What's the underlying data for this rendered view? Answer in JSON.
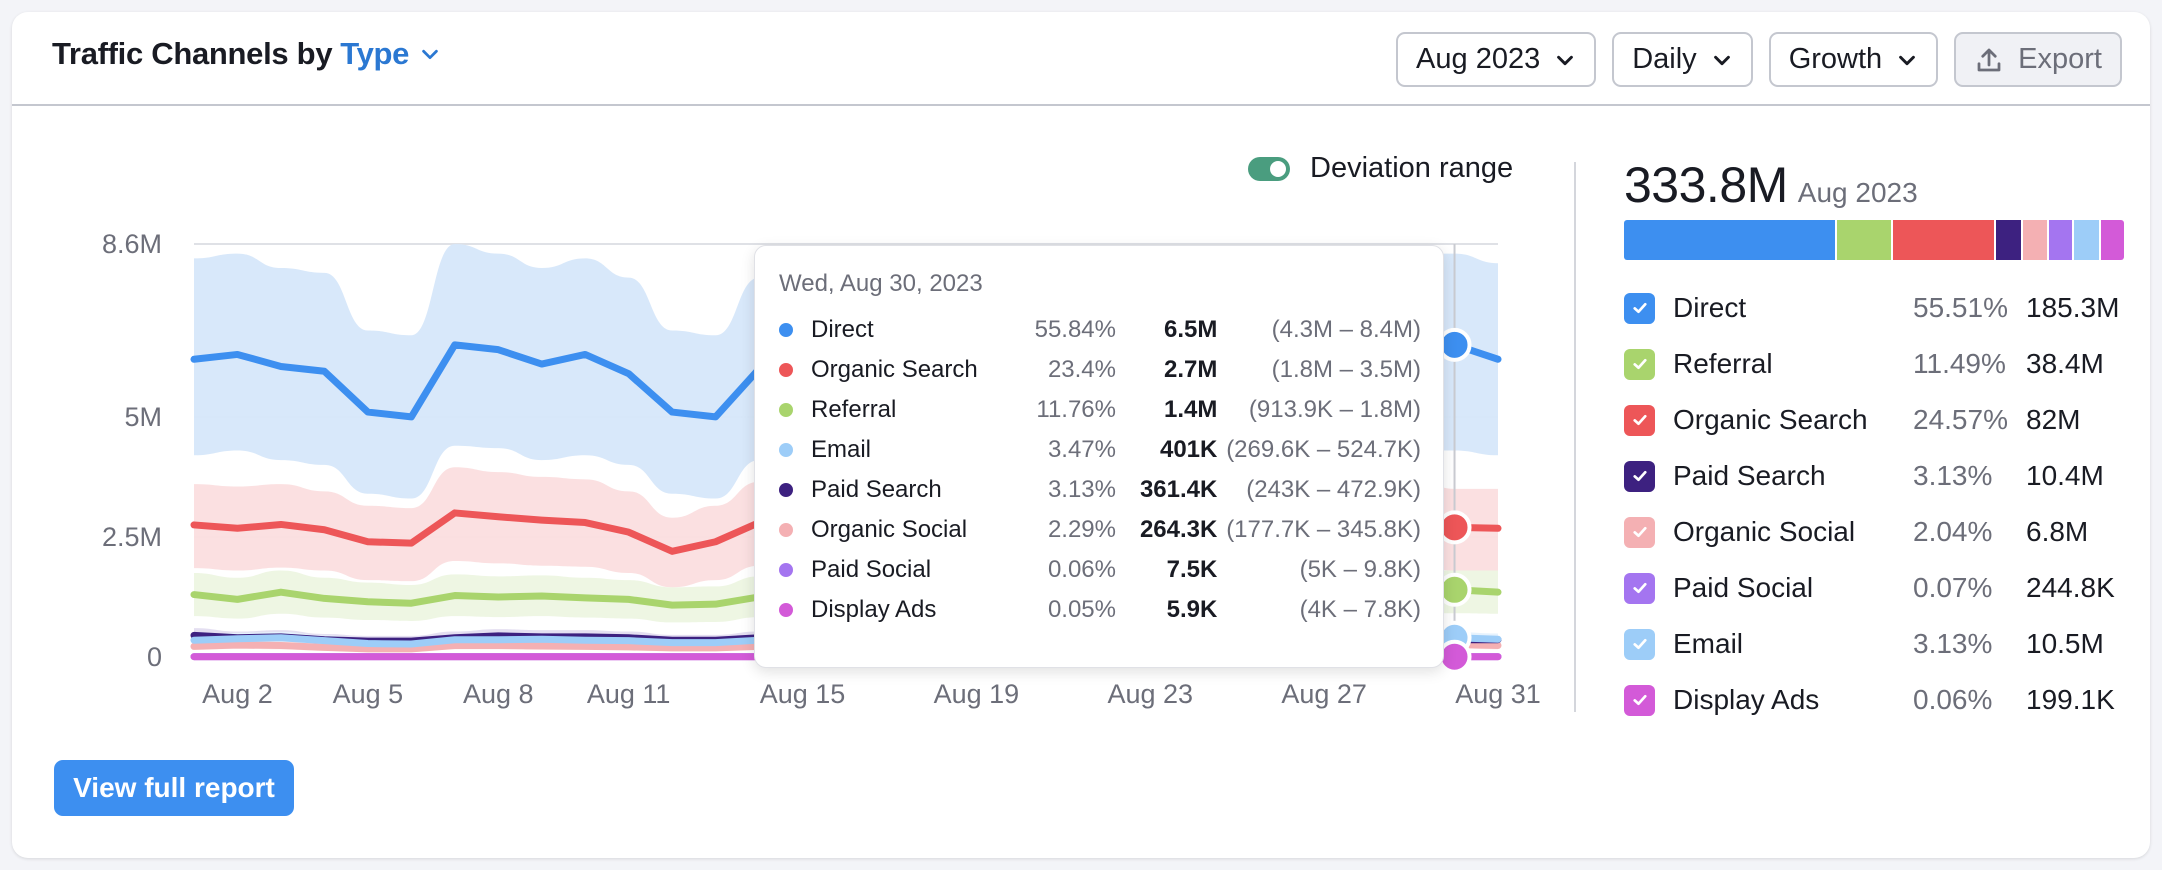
{
  "header": {
    "title_prefix": "Traffic Channels by",
    "title_type": "Type",
    "controls": {
      "period": "Aug 2023",
      "granularity": "Daily",
      "metric": "Growth",
      "export": "Export"
    }
  },
  "toggle": {
    "label": "Deviation range",
    "on": true
  },
  "summary": {
    "total": "333.8M",
    "period": "Aug 2023"
  },
  "legend": [
    {
      "name": "Direct",
      "pct": "55.51%",
      "value": "185.3M",
      "color": "#3d8ff0",
      "share": 55.51,
      "checked": true
    },
    {
      "name": "Referral",
      "pct": "11.49%",
      "value": "38.4M",
      "color": "#a9d46d",
      "share": 11.49,
      "checked": true
    },
    {
      "name": "Organic Search",
      "pct": "24.57%",
      "value": "82M",
      "color": "#ed5658",
      "share": 24.57,
      "checked": true
    },
    {
      "name": "Paid Search",
      "pct": "3.13%",
      "value": "10.4M",
      "color": "#3d2180",
      "share": 3.13,
      "checked": true
    },
    {
      "name": "Organic Social",
      "pct": "2.04%",
      "value": "6.8M",
      "color": "#f4b0b3",
      "share": 2.04,
      "checked": true
    },
    {
      "name": "Paid Social",
      "pct": "0.07%",
      "value": "244.8K",
      "color": "#a475f0",
      "share": 0.07,
      "checked": true
    },
    {
      "name": "Email",
      "pct": "3.13%",
      "value": "10.5M",
      "color": "#9dcdf8",
      "share": 3.13,
      "checked": true
    },
    {
      "name": "Display Ads",
      "pct": "0.06%",
      "value": "199.1K",
      "color": "#d35ad8",
      "share": 0.06,
      "checked": true
    }
  ],
  "tooltip": {
    "date": "Wed, Aug 30, 2023",
    "rows": [
      {
        "name": "Direct",
        "pct": "55.84%",
        "value": "6.5M",
        "range": "(4.3M – 8.4M)",
        "color": "#3d8ff0"
      },
      {
        "name": "Organic Search",
        "pct": "23.4%",
        "value": "2.7M",
        "range": "(1.8M – 3.5M)",
        "color": "#ed5658"
      },
      {
        "name": "Referral",
        "pct": "11.76%",
        "value": "1.4M",
        "range": "(913.9K – 1.8M)",
        "color": "#a9d46d"
      },
      {
        "name": "Email",
        "pct": "3.47%",
        "value": "401K",
        "range": "(269.6K – 524.7K)",
        "color": "#9dcdf8"
      },
      {
        "name": "Paid Search",
        "pct": "3.13%",
        "value": "361.4K",
        "range": "(243K – 472.9K)",
        "color": "#3d2180"
      },
      {
        "name": "Organic Social",
        "pct": "2.29%",
        "value": "264.3K",
        "range": "(177.7K – 345.8K)",
        "color": "#f4b0b3"
      },
      {
        "name": "Paid Social",
        "pct": "0.06%",
        "value": "7.5K",
        "range": "(5K – 9.8K)",
        "color": "#a475f0"
      },
      {
        "name": "Display Ads",
        "pct": "0.05%",
        "value": "5.9K",
        "range": "(4K – 7.8K)",
        "color": "#d35ad8"
      }
    ]
  },
  "view_full_report": "View full report",
  "chart_data": {
    "type": "line",
    "title": "Traffic Channels by Type",
    "xlabel": "",
    "ylabel": "",
    "x": [
      "Aug 1",
      "Aug 2",
      "Aug 3",
      "Aug 4",
      "Aug 5",
      "Aug 6",
      "Aug 7",
      "Aug 8",
      "Aug 9",
      "Aug 10",
      "Aug 11",
      "Aug 12",
      "Aug 13",
      "Aug 14",
      "Aug 15",
      "Aug 16",
      "Aug 17",
      "Aug 18",
      "Aug 19",
      "Aug 20",
      "Aug 21",
      "Aug 22",
      "Aug 23",
      "Aug 24",
      "Aug 25",
      "Aug 26",
      "Aug 27",
      "Aug 28",
      "Aug 29",
      "Aug 30",
      "Aug 31"
    ],
    "x_ticks": [
      "Aug 2",
      "Aug 5",
      "Aug 8",
      "Aug 11",
      "Aug 15",
      "Aug 19",
      "Aug 23",
      "Aug 27",
      "Aug 31"
    ],
    "y_ticks": [
      {
        "value": 0,
        "label": "0"
      },
      {
        "value": 2.5,
        "label": "2.5M"
      },
      {
        "value": 5,
        "label": "5M"
      },
      {
        "value": 8.6,
        "label": "8.6M"
      }
    ],
    "ylim": [
      0,
      8.6
    ],
    "units": "millions",
    "grid": true,
    "hover_index": 29,
    "series": [
      {
        "name": "Direct",
        "color": "#3d8ff0",
        "band": "#d6e7fa",
        "values": [
          6.2,
          6.3,
          6.05,
          5.95,
          5.1,
          5.0,
          6.5,
          6.4,
          6.1,
          6.3,
          5.9,
          5.1,
          5.0,
          6.0,
          6.2,
          6.3,
          6.1,
          6.0,
          5.3,
          5.2,
          6.3,
          6.4,
          6.2,
          6.3,
          6.0,
          5.3,
          5.2,
          6.3,
          6.4,
          6.5,
          6.2
        ],
        "lower": [
          4.2,
          4.3,
          4.1,
          4.0,
          3.4,
          3.3,
          4.4,
          4.35,
          4.1,
          4.2,
          4.0,
          3.4,
          3.3,
          4.1,
          4.2,
          4.3,
          4.1,
          4.0,
          3.5,
          3.4,
          4.3,
          4.4,
          4.2,
          4.3,
          4.0,
          3.5,
          3.4,
          4.2,
          4.3,
          4.3,
          4.2
        ],
        "upper": [
          8.3,
          8.4,
          8.1,
          8.0,
          6.8,
          6.7,
          8.6,
          8.4,
          8.1,
          8.3,
          7.9,
          6.8,
          6.7,
          7.9,
          8.3,
          8.4,
          8.1,
          8.0,
          7.0,
          6.9,
          8.3,
          8.4,
          8.2,
          8.3,
          8.0,
          7.0,
          6.9,
          8.3,
          8.4,
          8.4,
          8.2
        ]
      },
      {
        "name": "Organic Search",
        "color": "#ed5658",
        "band": "#fbdedf",
        "values": [
          2.75,
          2.68,
          2.76,
          2.65,
          2.4,
          2.37,
          3.0,
          2.92,
          2.85,
          2.8,
          2.6,
          2.2,
          2.4,
          2.8,
          2.85,
          2.9,
          2.8,
          2.75,
          2.5,
          2.45,
          2.85,
          2.9,
          2.8,
          2.82,
          2.7,
          2.5,
          2.45,
          2.8,
          2.85,
          2.7,
          2.68
        ],
        "lower": [
          1.85,
          1.8,
          1.86,
          1.8,
          1.6,
          1.58,
          2.0,
          1.95,
          1.9,
          1.88,
          1.75,
          1.45,
          1.6,
          1.9,
          1.9,
          1.95,
          1.9,
          1.85,
          1.65,
          1.62,
          1.9,
          1.95,
          1.9,
          1.9,
          1.8,
          1.65,
          1.62,
          1.9,
          1.9,
          1.8,
          1.8
        ],
        "upper": [
          3.6,
          3.55,
          3.6,
          3.45,
          3.15,
          3.1,
          3.95,
          3.85,
          3.75,
          3.7,
          3.45,
          2.9,
          3.15,
          3.65,
          3.75,
          3.8,
          3.7,
          3.6,
          3.3,
          3.2,
          3.75,
          3.8,
          3.7,
          3.7,
          3.55,
          3.3,
          3.2,
          3.7,
          3.75,
          3.5,
          3.5
        ]
      },
      {
        "name": "Referral",
        "color": "#a9d46d",
        "band": "#edf6e2",
        "values": [
          1.3,
          1.2,
          1.35,
          1.22,
          1.15,
          1.12,
          1.28,
          1.25,
          1.27,
          1.23,
          1.2,
          1.08,
          1.1,
          1.25,
          1.28,
          1.3,
          1.27,
          1.25,
          1.15,
          1.12,
          1.28,
          1.3,
          1.27,
          1.28,
          1.22,
          1.15,
          1.12,
          1.3,
          1.35,
          1.4,
          1.35
        ],
        "lower": [
          0.85,
          0.8,
          0.9,
          0.82,
          0.77,
          0.75,
          0.85,
          0.83,
          0.85,
          0.82,
          0.8,
          0.72,
          0.73,
          0.83,
          0.85,
          0.87,
          0.85,
          0.83,
          0.77,
          0.75,
          0.85,
          0.87,
          0.85,
          0.85,
          0.82,
          0.77,
          0.75,
          0.87,
          0.9,
          0.91,
          0.9
        ],
        "upper": [
          1.75,
          1.65,
          1.8,
          1.65,
          1.55,
          1.5,
          1.72,
          1.68,
          1.7,
          1.65,
          1.6,
          1.45,
          1.47,
          1.68,
          1.7,
          1.75,
          1.7,
          1.68,
          1.55,
          1.5,
          1.72,
          1.75,
          1.7,
          1.72,
          1.65,
          1.55,
          1.5,
          1.75,
          1.8,
          1.8,
          1.8
        ]
      },
      {
        "name": "Paid Search",
        "color": "#3d2180",
        "band": "#e3ddf0",
        "values": [
          0.45,
          0.4,
          0.42,
          0.36,
          0.33,
          0.33,
          0.4,
          0.44,
          0.42,
          0.42,
          0.4,
          0.35,
          0.35,
          0.4,
          0.42,
          0.44,
          0.42,
          0.4,
          0.36,
          0.35,
          0.42,
          0.44,
          0.42,
          0.42,
          0.4,
          0.36,
          0.35,
          0.42,
          0.44,
          0.36,
          0.36
        ],
        "lower": [
          0.3,
          0.27,
          0.28,
          0.24,
          0.22,
          0.22,
          0.27,
          0.29,
          0.28,
          0.28,
          0.27,
          0.23,
          0.23,
          0.27,
          0.28,
          0.29,
          0.28,
          0.27,
          0.24,
          0.23,
          0.28,
          0.29,
          0.28,
          0.28,
          0.27,
          0.24,
          0.23,
          0.28,
          0.29,
          0.24,
          0.24
        ],
        "upper": [
          0.6,
          0.53,
          0.56,
          0.48,
          0.44,
          0.44,
          0.53,
          0.58,
          0.56,
          0.56,
          0.53,
          0.46,
          0.46,
          0.53,
          0.56,
          0.58,
          0.56,
          0.53,
          0.48,
          0.46,
          0.56,
          0.58,
          0.56,
          0.56,
          0.53,
          0.48,
          0.46,
          0.56,
          0.58,
          0.47,
          0.47
        ]
      },
      {
        "name": "Email",
        "color": "#9dcdf8",
        "band": "#e6f2fd",
        "values": [
          0.35,
          0.38,
          0.4,
          0.34,
          0.28,
          0.27,
          0.36,
          0.36,
          0.37,
          0.35,
          0.34,
          0.3,
          0.3,
          0.35,
          0.37,
          0.38,
          0.37,
          0.36,
          0.31,
          0.3,
          0.37,
          0.38,
          0.37,
          0.37,
          0.35,
          0.31,
          0.3,
          0.37,
          0.38,
          0.4,
          0.37
        ],
        "lower": [
          0.24,
          0.26,
          0.27,
          0.23,
          0.19,
          0.18,
          0.24,
          0.24,
          0.25,
          0.24,
          0.23,
          0.2,
          0.2,
          0.24,
          0.25,
          0.26,
          0.25,
          0.24,
          0.21,
          0.2,
          0.25,
          0.26,
          0.25,
          0.25,
          0.24,
          0.21,
          0.2,
          0.25,
          0.26,
          0.27,
          0.25
        ],
        "upper": [
          0.46,
          0.5,
          0.52,
          0.45,
          0.37,
          0.36,
          0.47,
          0.47,
          0.48,
          0.46,
          0.45,
          0.4,
          0.4,
          0.46,
          0.48,
          0.5,
          0.48,
          0.47,
          0.41,
          0.4,
          0.48,
          0.5,
          0.48,
          0.48,
          0.46,
          0.41,
          0.4,
          0.48,
          0.5,
          0.52,
          0.49
        ]
      },
      {
        "name": "Organic Social",
        "color": "#f4b0b3",
        "band": "#fdebec",
        "values": [
          0.22,
          0.25,
          0.24,
          0.2,
          0.17,
          0.17,
          0.24,
          0.24,
          0.23,
          0.22,
          0.21,
          0.19,
          0.19,
          0.22,
          0.23,
          0.24,
          0.23,
          0.22,
          0.19,
          0.19,
          0.23,
          0.24,
          0.23,
          0.23,
          0.22,
          0.19,
          0.19,
          0.23,
          0.24,
          0.26,
          0.24
        ],
        "lower": [
          0.15,
          0.17,
          0.16,
          0.13,
          0.11,
          0.11,
          0.16,
          0.16,
          0.15,
          0.15,
          0.14,
          0.13,
          0.13,
          0.15,
          0.15,
          0.16,
          0.15,
          0.15,
          0.13,
          0.13,
          0.15,
          0.16,
          0.15,
          0.15,
          0.15,
          0.13,
          0.13,
          0.15,
          0.16,
          0.18,
          0.16
        ],
        "upper": [
          0.29,
          0.33,
          0.32,
          0.27,
          0.22,
          0.22,
          0.32,
          0.32,
          0.3,
          0.29,
          0.28,
          0.25,
          0.25,
          0.29,
          0.3,
          0.32,
          0.3,
          0.29,
          0.25,
          0.25,
          0.3,
          0.32,
          0.3,
          0.3,
          0.29,
          0.25,
          0.25,
          0.3,
          0.32,
          0.35,
          0.32
        ]
      },
      {
        "name": "Paid Social",
        "color": "#a475f0",
        "band": "#efe6fd",
        "values": [
          0.008,
          0.008,
          0.008,
          0.008,
          0.007,
          0.007,
          0.008,
          0.008,
          0.008,
          0.008,
          0.008,
          0.007,
          0.007,
          0.008,
          0.008,
          0.008,
          0.008,
          0.008,
          0.007,
          0.007,
          0.008,
          0.008,
          0.008,
          0.008,
          0.008,
          0.007,
          0.007,
          0.008,
          0.008,
          0.0075,
          0.0075
        ],
        "lower": [
          0.005,
          0.005,
          0.005,
          0.005,
          0.005,
          0.005,
          0.005,
          0.005,
          0.005,
          0.005,
          0.005,
          0.005,
          0.005,
          0.005,
          0.005,
          0.005,
          0.005,
          0.005,
          0.005,
          0.005,
          0.005,
          0.005,
          0.005,
          0.005,
          0.005,
          0.005,
          0.005,
          0.005,
          0.005,
          0.005,
          0.005
        ],
        "upper": [
          0.01,
          0.01,
          0.01,
          0.01,
          0.009,
          0.009,
          0.01,
          0.01,
          0.01,
          0.01,
          0.01,
          0.009,
          0.009,
          0.01,
          0.01,
          0.01,
          0.01,
          0.01,
          0.009,
          0.009,
          0.01,
          0.01,
          0.01,
          0.01,
          0.01,
          0.009,
          0.009,
          0.01,
          0.01,
          0.0098,
          0.0098
        ]
      },
      {
        "name": "Display Ads",
        "color": "#d35ad8",
        "band": "#f8e3f9",
        "values": [
          0.006,
          0.006,
          0.006,
          0.006,
          0.006,
          0.006,
          0.006,
          0.006,
          0.006,
          0.006,
          0.006,
          0.006,
          0.006,
          0.006,
          0.006,
          0.006,
          0.006,
          0.006,
          0.006,
          0.006,
          0.006,
          0.006,
          0.006,
          0.006,
          0.006,
          0.006,
          0.006,
          0.006,
          0.006,
          0.0059,
          0.0059
        ],
        "lower": [
          0.004,
          0.004,
          0.004,
          0.004,
          0.004,
          0.004,
          0.004,
          0.004,
          0.004,
          0.004,
          0.004,
          0.004,
          0.004,
          0.004,
          0.004,
          0.004,
          0.004,
          0.004,
          0.004,
          0.004,
          0.004,
          0.004,
          0.004,
          0.004,
          0.004,
          0.004,
          0.004,
          0.004,
          0.004,
          0.004,
          0.004
        ],
        "upper": [
          0.008,
          0.008,
          0.008,
          0.008,
          0.008,
          0.008,
          0.008,
          0.008,
          0.008,
          0.008,
          0.008,
          0.008,
          0.008,
          0.008,
          0.008,
          0.008,
          0.008,
          0.008,
          0.008,
          0.008,
          0.008,
          0.008,
          0.008,
          0.008,
          0.008,
          0.008,
          0.008,
          0.008,
          0.008,
          0.0078,
          0.0078
        ]
      }
    ]
  }
}
